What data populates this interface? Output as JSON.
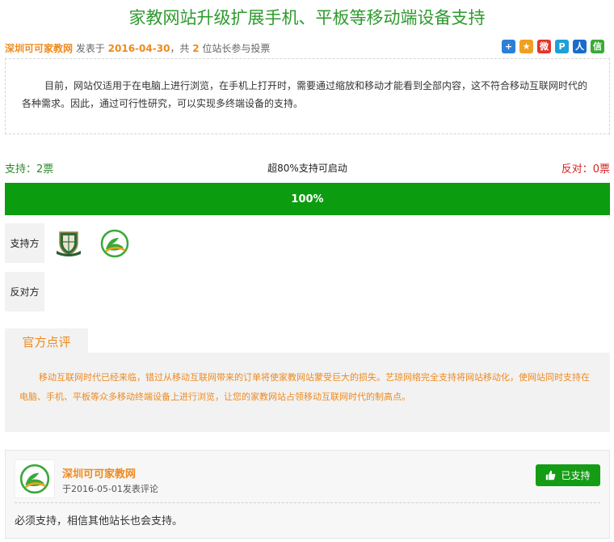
{
  "title": "家教网站升级扩展手机、平板等移动端设备支持",
  "meta": {
    "author": "深圳可可家教网",
    "posted_prefix": " 发表于 ",
    "date": "2016-04-30",
    "participants_prefix": "，共 ",
    "participants_count": "2",
    "participants_suffix": " 位站长参与投票"
  },
  "share": [
    {
      "name": "share-more-icon",
      "glyph": "+",
      "color": "#2d7fd8"
    },
    {
      "name": "share-qzone-icon",
      "glyph": "★",
      "color": "#f0a020"
    },
    {
      "name": "share-weibo-icon",
      "glyph": "微",
      "color": "#e2352b"
    },
    {
      "name": "share-tqq-icon",
      "glyph": "P",
      "color": "#1e9fd8"
    },
    {
      "name": "share-renren-icon",
      "glyph": "人",
      "color": "#1a6cc8"
    },
    {
      "name": "share-wechat-icon",
      "glyph": "信",
      "color": "#3aaa35"
    }
  ],
  "intro": "目前，网站仅适用于在电脑上进行浏览，在手机上打开时，需要通过缩放和移动才能看到全部内容，这不符合移动互联网时代的各种需求。因此，通过可行性研究，可以实现多终端设备的支持。",
  "vote": {
    "support_label": "支持：2票",
    "rule_label": "超80%支持可启动",
    "oppose_label": "反对：0票",
    "percent_label": "100%",
    "support_fraction": 1.0,
    "bar_color": "#0c9c10"
  },
  "sides": {
    "support_label": "支持方",
    "oppose_label": "反对方"
  },
  "review": {
    "tab_label": "官方点评",
    "text": "移动互联网时代已经来临，错过从移动互联网带来的订单将使家教网站蒙受巨大的损失。艺琼网络完全支持将网站移动化，使网站同时支持在电脑、手机、平板等众多移动终端设备上进行浏览，让您的家教网站占领移动互联网时代的制高点。"
  },
  "comment": {
    "name": "深圳可可家教网",
    "time": "于2016-05-01发表评论",
    "button_label": "已支持",
    "text": "必须支持，相信其他站长也会支持。"
  },
  "colors": {
    "accent_green": "#2e9a2e",
    "accent_orange": "#ee8a1e",
    "oppose_red": "#d32222"
  }
}
